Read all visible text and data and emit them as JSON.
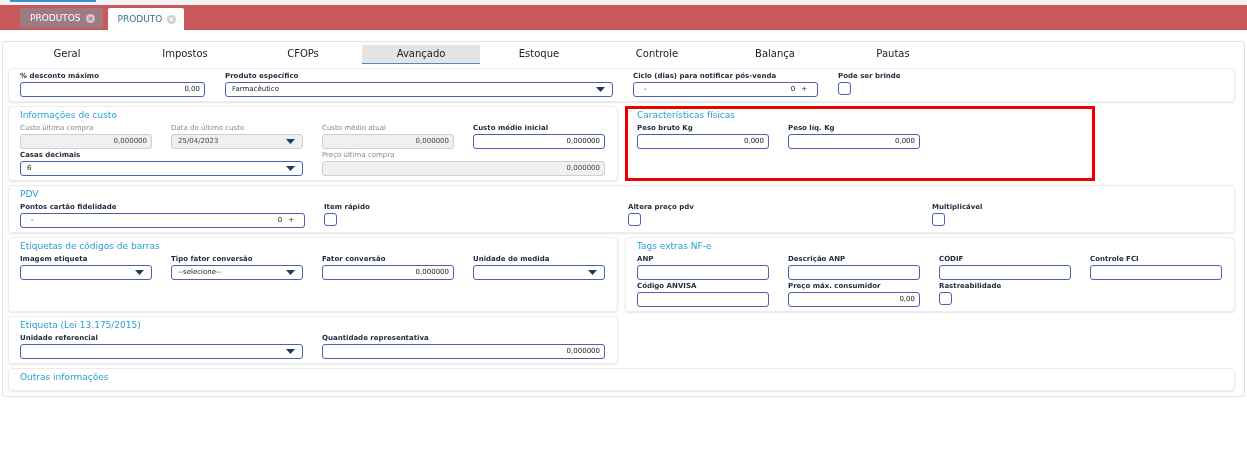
{
  "app_tabs": [
    {
      "label": "PRODUTOS",
      "selected": false
    },
    {
      "label": "PRODUTO",
      "selected": true
    }
  ],
  "form_tabs": [
    {
      "label": "Geral",
      "selected": false
    },
    {
      "label": "Impostos",
      "selected": false
    },
    {
      "label": "CFOPs",
      "selected": false
    },
    {
      "label": "Avançado",
      "selected": true
    },
    {
      "label": "Estoque",
      "selected": false
    },
    {
      "label": "Controle",
      "selected": false
    },
    {
      "label": "Balança",
      "selected": false
    },
    {
      "label": "Pautas",
      "selected": false
    }
  ],
  "sections": [
    {
      "kind": "top",
      "fields": [
        {
          "kind": "text",
          "label": "% desconto máximo",
          "value": "0,00"
        },
        {
          "kind": "select",
          "label": "Produto específico",
          "value": "Farmacêutico"
        },
        {
          "kind": "spinner",
          "label": "Ciclo (dias) para notificar pós-venda",
          "minus": "-",
          "value": "0",
          "plus": "+"
        },
        {
          "kind": "checkbox",
          "label": "Pode ser brinde",
          "checked": false
        }
      ]
    },
    {
      "kind": "half",
      "title": "Informações de custo",
      "highlighted": false,
      "fields": [
        {
          "kind": "readonly",
          "label": "Custo última compra",
          "value": "0,000000",
          "wide": false
        },
        {
          "kind": "readonly-select",
          "label": "Data do último custo",
          "value": "25/04/2023",
          "wide": false
        },
        {
          "kind": "readonly",
          "label": "Custo médio atual",
          "value": "0,000000",
          "wide": false
        },
        {
          "kind": "text",
          "label": "Custo médio inicial",
          "value": "0,000000",
          "wide": false
        },
        {
          "kind": "select",
          "label": "Casas decimais",
          "value": "6",
          "wide": true
        },
        {
          "kind": "readonly",
          "label": "Preço última compra",
          "value": "0,000000",
          "wide": true
        }
      ]
    },
    {
      "kind": "half",
      "title": "Características físicas",
      "highlighted": true,
      "fields": [
        {
          "kind": "text",
          "label": "Peso bruto Kg",
          "value": "0,000",
          "wide": false
        },
        {
          "kind": "text",
          "label": "Peso líq. Kg",
          "value": "0,000",
          "wide": false
        }
      ]
    },
    {
      "kind": "pdv",
      "title": "PDV",
      "fields": [
        {
          "kind": "spinner",
          "label": "Pontos cartão fidelidade",
          "minus": "-",
          "value": "0",
          "plus": "+"
        },
        {
          "kind": "checkbox",
          "label": "Item rápido",
          "checked": false
        },
        {
          "kind": "checkbox",
          "label": "Altera preço pdv",
          "checked": false
        },
        {
          "kind": "checkbox",
          "label": "Multiplicável",
          "checked": false
        }
      ]
    },
    {
      "kind": "half",
      "title": "Etiquetas de códigos de barras",
      "highlighted": false,
      "fields": [
        {
          "kind": "select",
          "label": "Imagem etiqueta",
          "wide": false
        },
        {
          "kind": "select",
          "label": "Tipo fator conversão",
          "value": "--selecione--",
          "wide": false
        },
        {
          "kind": "text",
          "label": "Fator conversão",
          "value": "0,000000",
          "wide": false
        },
        {
          "kind": "select",
          "label": "Unidade de medida",
          "wide": false
        }
      ]
    },
    {
      "kind": "half",
      "title": "Tags extras NF-e",
      "highlighted": false,
      "fields": [
        {
          "kind": "text",
          "label": "ANP",
          "wide": false
        },
        {
          "kind": "text",
          "label": "Descrição ANP",
          "wide": false
        },
        {
          "kind": "text",
          "label": "CODIF",
          "wide": false
        },
        {
          "kind": "text",
          "label": "Controle FCI",
          "wide": false
        },
        {
          "kind": "text",
          "label": "Código ANVISA",
          "wide": false
        },
        {
          "kind": "text",
          "label": "Preço máx. consumidor",
          "value": "0,00",
          "wide": false
        },
        {
          "kind": "checkbox",
          "label": "Rastreabilidade",
          "checked": false
        }
      ]
    },
    {
      "kind": "half",
      "title": "Etiqueta (Lei 13.175/2015)",
      "highlighted": false,
      "fields": [
        {
          "kind": "select",
          "label": "Unidade referencial",
          "wide": true
        },
        {
          "kind": "text",
          "label": "Quantidade representativa",
          "value": "0,000000",
          "wide": true
        }
      ]
    },
    {
      "kind": "full",
      "title": "Outras informações"
    }
  ]
}
